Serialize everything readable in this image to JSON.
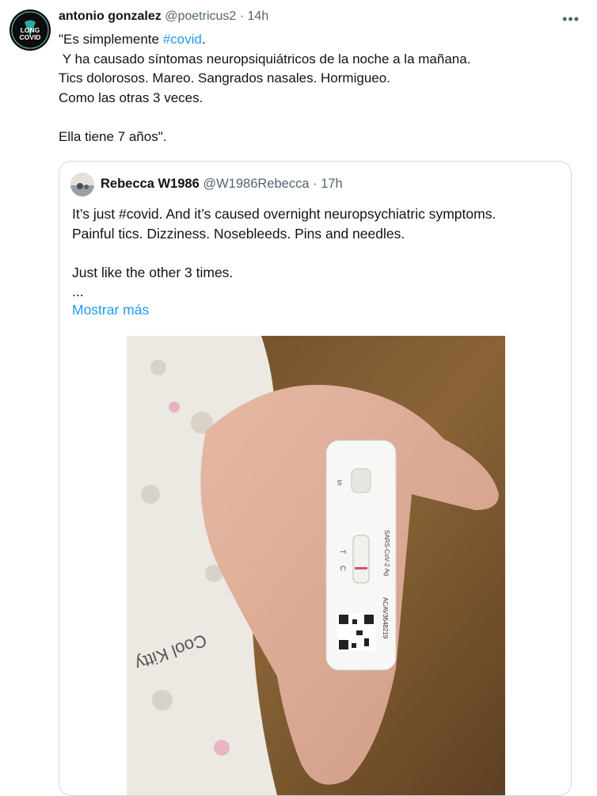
{
  "tweet": {
    "author_name": "antonio gonzalez",
    "handle": "@poetricus2",
    "separator": "·",
    "time": "14h",
    "more_label": "•••",
    "avatar_text": {
      "top": "LONG",
      "bottom": "COVID"
    },
    "lines": [
      {
        "before": "\"Es simplemente ",
        "hashtag": "#covid",
        "after": "."
      },
      {
        "before": " Y ha causado síntomas neuropsiquiátricos de la noche a la mañana.",
        "hashtag": "",
        "after": ""
      },
      {
        "before": "Tics dolorosos. Mareo. Sangrados nasales. Hormigueo.",
        "hashtag": "",
        "after": ""
      },
      {
        "before": "Como las otras 3 veces.",
        "hashtag": "",
        "after": ""
      },
      {
        "before": "",
        "hashtag": "",
        "after": ""
      },
      {
        "before": "Ella tiene 7 años\".",
        "hashtag": "",
        "after": ""
      }
    ]
  },
  "quote": {
    "author_name": "Rebecca W1986",
    "handle": "@W1986Rebecca",
    "separator": "·",
    "time": "17h",
    "lines": [
      "It’s just #covid. And it’s caused overnight neuropsychiatric symptoms.",
      "Painful tics. Dizziness. Nosebleeds. Pins and needles.",
      "",
      "Just like the other 3 times.",
      "..."
    ],
    "show_more": "Mostrar más",
    "photo": {
      "test_letters": {
        "s": "S",
        "t": "T",
        "c": "C"
      },
      "test_label": "SARS-CoV-2 Ag",
      "test_code": "ACAV3648219",
      "shirt_text": "Cool Kitty"
    }
  },
  "colors": {
    "link": "#1d9bf0",
    "secondary": "#536471",
    "border": "#cfd9de"
  }
}
